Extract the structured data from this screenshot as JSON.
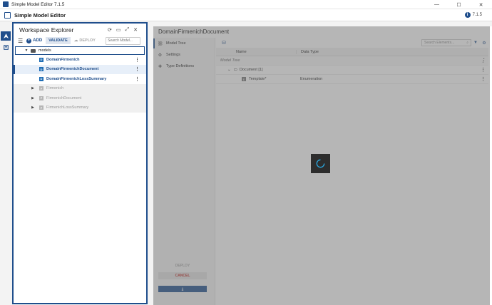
{
  "window": {
    "title": "Simple Model Editor 7.1.5",
    "minimize": "—",
    "maximize": "☐",
    "close": "✕"
  },
  "appbar": {
    "name": "Simple Model Editor",
    "version": "7.1.5",
    "info": "i"
  },
  "explorer": {
    "title": "Workspace Explorer",
    "add_label": "ADD",
    "validate_label": "VALIDATE",
    "deploy_label": "DEPLOY",
    "search_placeholder": "Search Model...",
    "folder": "models",
    "items": [
      {
        "label": "DomainFirmenich",
        "icon": "D"
      },
      {
        "label": "DomainFirmenichDocument",
        "icon": "D"
      },
      {
        "label": "DomainFirmenichLossSummary",
        "icon": "D"
      },
      {
        "label": "Firmenich",
        "icon": "F"
      },
      {
        "label": "FirmenichDocument",
        "icon": "F"
      },
      {
        "label": "FirmenichLossSummary",
        "icon": "F"
      }
    ]
  },
  "main": {
    "title": "DomainFirmenichDocument",
    "nav": [
      {
        "label": "Model Tree"
      },
      {
        "label": "Settings"
      },
      {
        "label": "Type Definitions"
      }
    ],
    "deploy_label": "DEPLOY",
    "cancel_label": "CANCEL",
    "save_label": "⤓",
    "search_placeholder": "Search Elements...",
    "columns": {
      "name": "Name",
      "type": "Data Type"
    },
    "group_row": "Model Tree",
    "rows": [
      {
        "name": "Document [1]",
        "type": ""
      },
      {
        "name": "Template*",
        "icon": "E",
        "type": "Enumeration"
      }
    ]
  },
  "colors": {
    "accent": "#1f4e8c",
    "cancel": "#c0302a",
    "spinner": "#29a8e0"
  }
}
